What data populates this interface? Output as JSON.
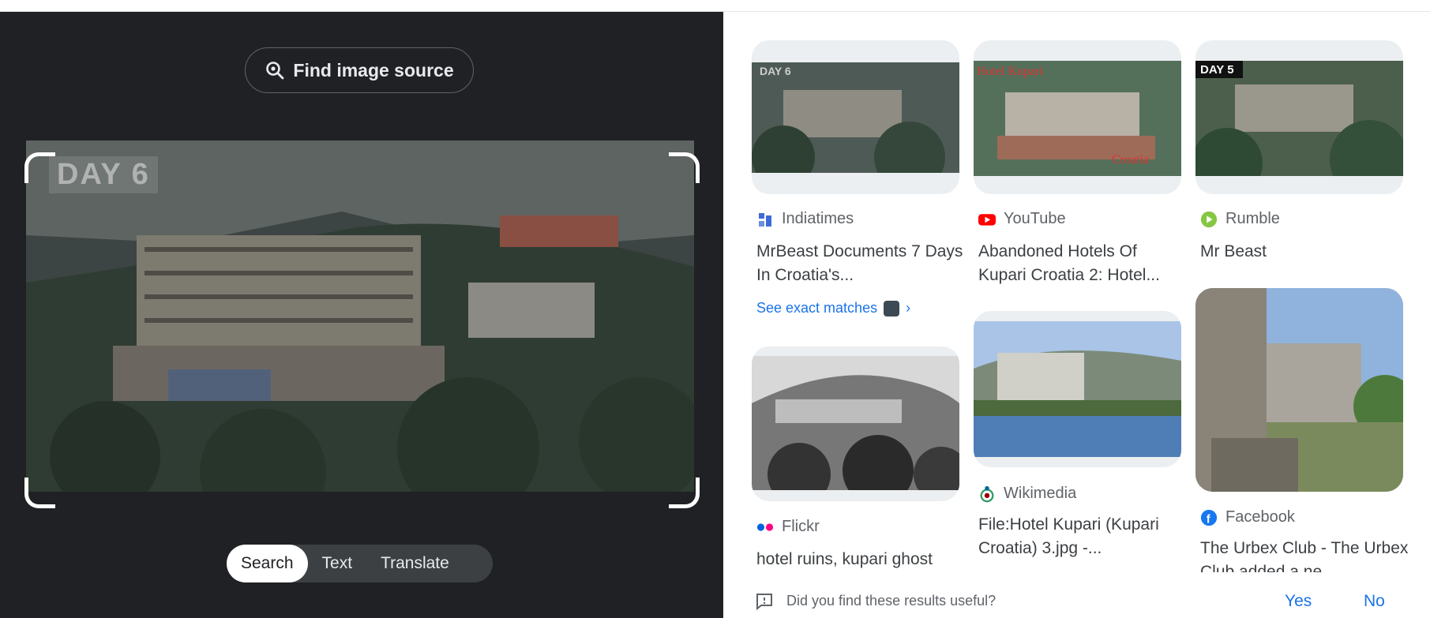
{
  "find_button": {
    "label": "Find image source",
    "icon": "lens-search-icon"
  },
  "crop_overlay_text": "DAY 6",
  "modes": [
    {
      "label": "Search",
      "active": true
    },
    {
      "label": "Text",
      "active": false
    },
    {
      "label": "Translate",
      "active": false
    }
  ],
  "results": [
    {
      "source": "Indiatimes",
      "title": "MrBeast Documents 7 Days In Croatia's...",
      "overlay": "DAY 6",
      "icon": "indiatimes-icon",
      "see_exact": "See exact matches"
    },
    {
      "source": "YouTube",
      "title": "Abandoned Hotels Of Kupari Croatia 2: Hotel...",
      "overlay": "Hotel Kupari",
      "overlay2": "Croatia",
      "icon": "youtube-icon"
    },
    {
      "source": "Rumble",
      "title": "Mr Beast",
      "overlay": "DAY 5",
      "icon": "rumble-icon"
    },
    {
      "source": "Flickr",
      "title": "hotel ruins, kupari ghost",
      "icon": "flickr-icon"
    },
    {
      "source": "Wikimedia",
      "title": "File:Hotel Kupari (Kupari Croatia) 3.jpg -...",
      "icon": "wikimedia-icon"
    },
    {
      "source": "Facebook",
      "title": "The Urbex Club - The Urbex Club added a ne...",
      "icon": "facebook-icon"
    }
  ],
  "feedback": {
    "question": "Did you find these results useful?",
    "yes": "Yes",
    "no": "No"
  },
  "colors": {
    "dark_bg": "#202124",
    "link": "#1a73e8"
  }
}
